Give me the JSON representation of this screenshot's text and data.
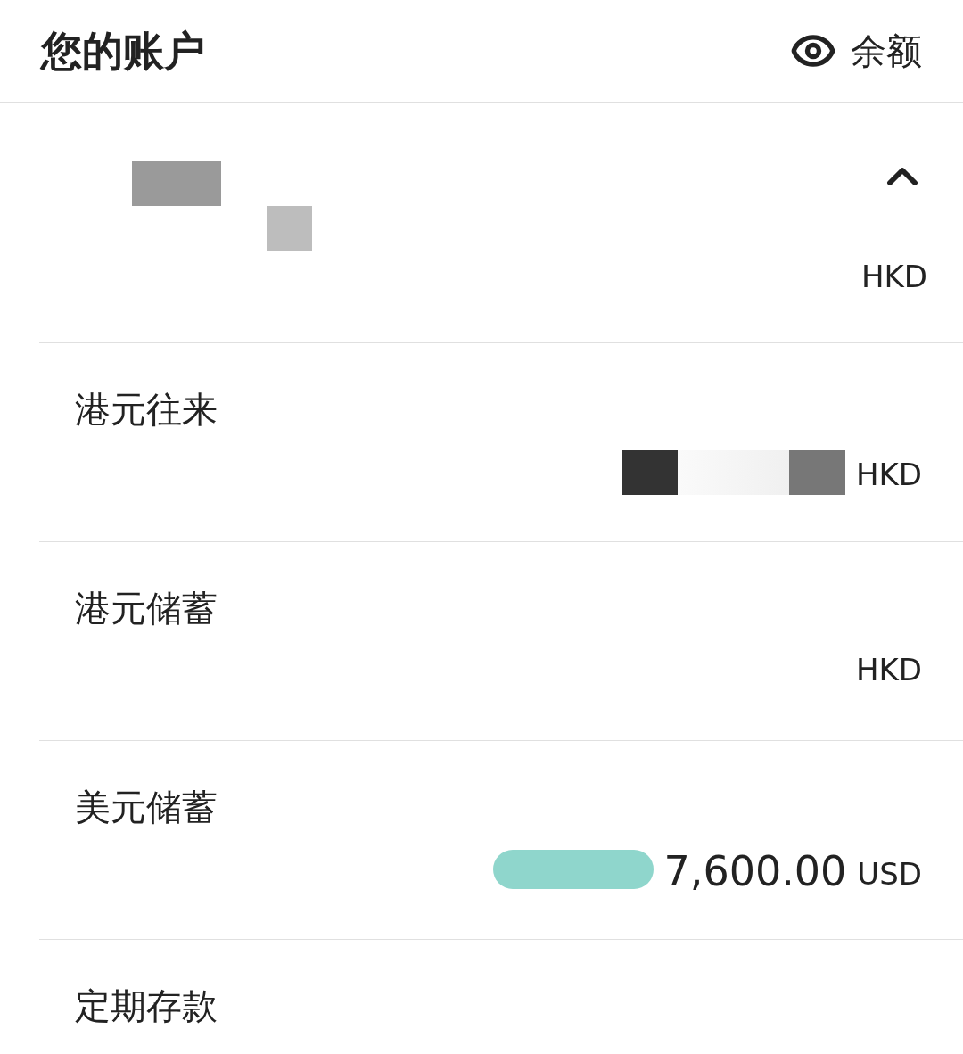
{
  "header": {
    "title": "您的账户",
    "balance_toggle": {
      "label": "余额",
      "visible": true
    }
  },
  "account_group": {
    "expanded": true,
    "currency": "HKD"
  },
  "accounts": [
    {
      "name": "港元往来",
      "currency": "HKD",
      "redacted": true
    },
    {
      "name": "港元储蓄",
      "currency": "HKD",
      "redacted": false
    },
    {
      "name": "美元储蓄",
      "amount": "7,600.00",
      "currency": "USD",
      "redacted": true
    },
    {
      "name": "定期存款"
    }
  ]
}
